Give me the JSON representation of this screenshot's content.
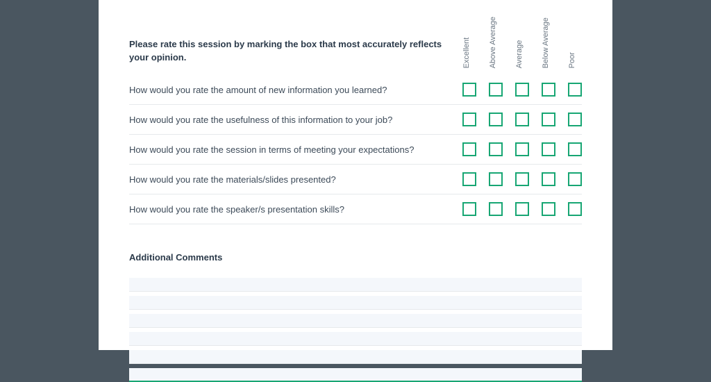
{
  "rating": {
    "instruction": "Please rate this session by marking the box that most accurately reflects your opinion.",
    "scale": [
      "Excellent",
      "Above Average",
      "Average",
      "Below Average",
      "Poor"
    ],
    "questions": [
      "How would you rate the amount of new information you learned?",
      "How would you rate the usefulness of this information to your job?",
      "How would you rate the session in terms of meeting your expectations?",
      "How would you rate the materials/slides presented?",
      "How would you rate the speaker/s presentation skills?"
    ]
  },
  "comments": {
    "title": "Additional Comments",
    "lines": 6
  }
}
